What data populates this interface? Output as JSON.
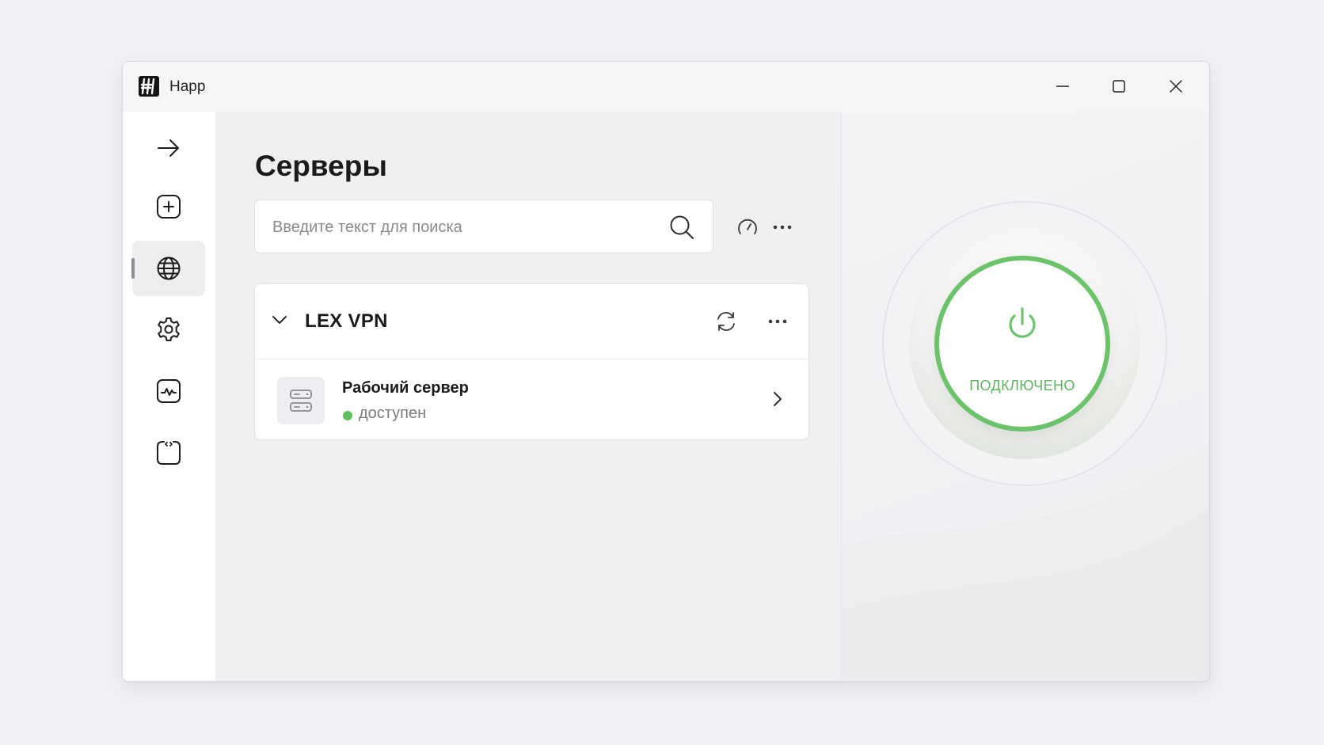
{
  "window": {
    "title": "Happ"
  },
  "sidebar": {
    "items": [
      {
        "name": "arrow-right-icon",
        "active": false
      },
      {
        "name": "add-square-icon",
        "active": false
      },
      {
        "name": "globe-icon",
        "active": true
      },
      {
        "name": "gear-icon",
        "active": false
      },
      {
        "name": "activity-chart-icon",
        "active": false
      },
      {
        "name": "code-frame-icon",
        "active": false
      }
    ]
  },
  "main": {
    "title": "Серверы",
    "search": {
      "placeholder": "Введите текст для поиска",
      "value": ""
    },
    "groups": [
      {
        "name": "LEX VPN",
        "expanded": true,
        "servers": [
          {
            "name": "Рабочий сервер",
            "status": "доступен",
            "status_color": "#5ec15e"
          }
        ]
      }
    ]
  },
  "connection": {
    "state_label": "ПОДКЛЮЧЕНО",
    "accent_color": "#6cc36b"
  }
}
